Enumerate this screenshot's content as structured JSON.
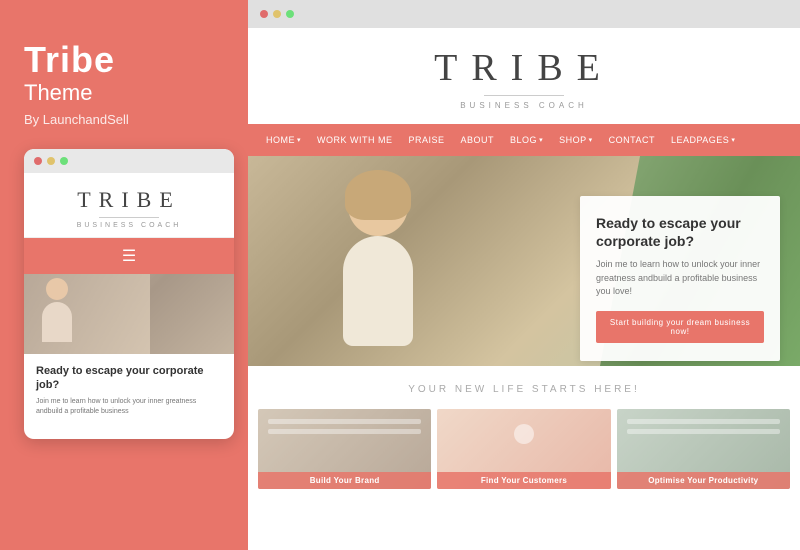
{
  "left": {
    "title": "Tribe",
    "subtitle": "Theme",
    "author": "By LaunchandSell"
  },
  "mobile": {
    "logo": "TRIBE",
    "logo_sub": "BUSINESS COACH",
    "headline": "Ready to escape your corporate job?",
    "body_text": "Join me to learn how to unlock your inner greatness andbuild a profitable business"
  },
  "desktop": {
    "logo": "TRIBE",
    "logo_sub": "BUSINESS COACH",
    "nav_items": [
      "HOME",
      "WORK WITH ME",
      "PRAISE",
      "ABOUT",
      "BLOG",
      "SHOP",
      "CONTACT",
      "LEADPAGES"
    ],
    "hero_title": "Ready to escape your corporate job?",
    "hero_text": "Join me to learn how to unlock your inner greatness andbuild a profitable business you love!",
    "hero_btn": "Start building your dream business now!",
    "section_title": "YOUR NEW LIFE STARTS HERE!",
    "cards": [
      {
        "label": "Build Your Brand"
      },
      {
        "label": "Find Your Customers"
      },
      {
        "label": "Optimise Your Productivity"
      }
    ]
  },
  "dots": {
    "red": "#e06c6c",
    "yellow": "#e0c36c",
    "green": "#6ce07a"
  },
  "accent": "#e8756a"
}
